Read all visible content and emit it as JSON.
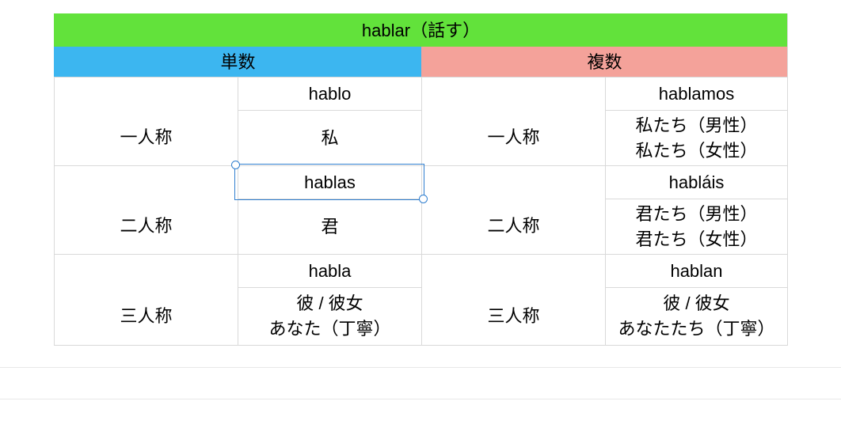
{
  "title": "hablar（話す）",
  "columns": {
    "singular": "単数",
    "plural": "複数"
  },
  "persons": {
    "first": "一人称",
    "second": "二人称",
    "third": "三人称"
  },
  "chart_data": {
    "type": "table",
    "title": "hablar（話す）",
    "rows": [
      {
        "person": "一人称",
        "singular_form": "hablo",
        "singular_translation": [
          "私"
        ],
        "plural_form": "hablamos",
        "plural_translation": [
          "私たち（男性）",
          "私たち（女性）"
        ]
      },
      {
        "person": "二人称",
        "singular_form": "hablas",
        "singular_translation": [
          "君"
        ],
        "plural_form": "habláis",
        "plural_translation": [
          "君たち（男性）",
          "君たち（女性）"
        ]
      },
      {
        "person": "三人称",
        "singular_form": "habla",
        "singular_translation": [
          "彼 / 彼女",
          "あなた（丁寧）"
        ],
        "plural_form": "hablan",
        "plural_translation": [
          "彼 / 彼女",
          "あなたたち（丁寧）"
        ]
      }
    ]
  },
  "colors": {
    "title_bg": "#62e23b",
    "singular_bg": "#3cb6f0",
    "plural_bg": "#f4a29a",
    "selection": "#2f7ecf"
  },
  "selection": {
    "cell": "二人称・単数・活用形 (hablas)"
  }
}
